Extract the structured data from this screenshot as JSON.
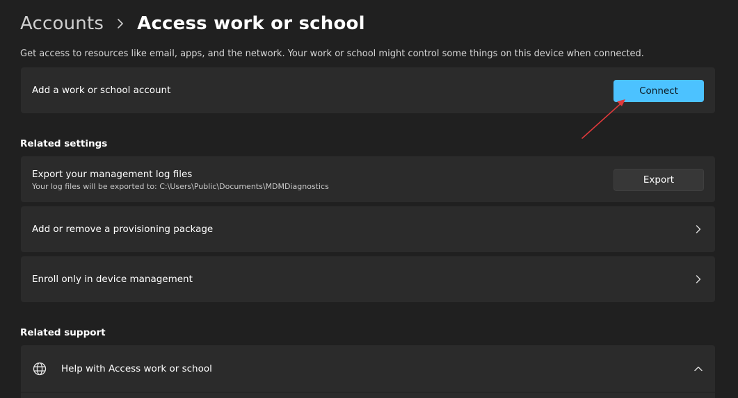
{
  "header": {
    "breadcrumb_parent": "Accounts",
    "breadcrumb_current": "Access work or school",
    "separator_icon": "chevron-right-icon"
  },
  "description": "Get access to resources like email, apps, and the network. Your work or school might control some things on this device when connected.",
  "add_account": {
    "label": "Add a work or school account",
    "button_label": "Connect"
  },
  "related_settings": {
    "heading": "Related settings",
    "export": {
      "label": "Export your management log files",
      "subtext": "Your log files will be exported to: C:\\Users\\Public\\Documents\\MDMDiagnostics",
      "button_label": "Export"
    },
    "provisioning": {
      "label": "Add or remove a provisioning package",
      "icon": "chevron-right-icon"
    },
    "enroll": {
      "label": "Enroll only in device management",
      "icon": "chevron-right-icon"
    }
  },
  "related_support": {
    "heading": "Related support",
    "help": {
      "label": "Help with Access work or school",
      "icon": "globe-icon",
      "expand_icon": "chevron-up-icon"
    }
  },
  "annotation": {
    "icon": "red-arrow-icon",
    "color": "#e0393b"
  },
  "colors": {
    "background": "#202020",
    "card": "#2b2b2b",
    "accent": "#4cc2ff"
  }
}
